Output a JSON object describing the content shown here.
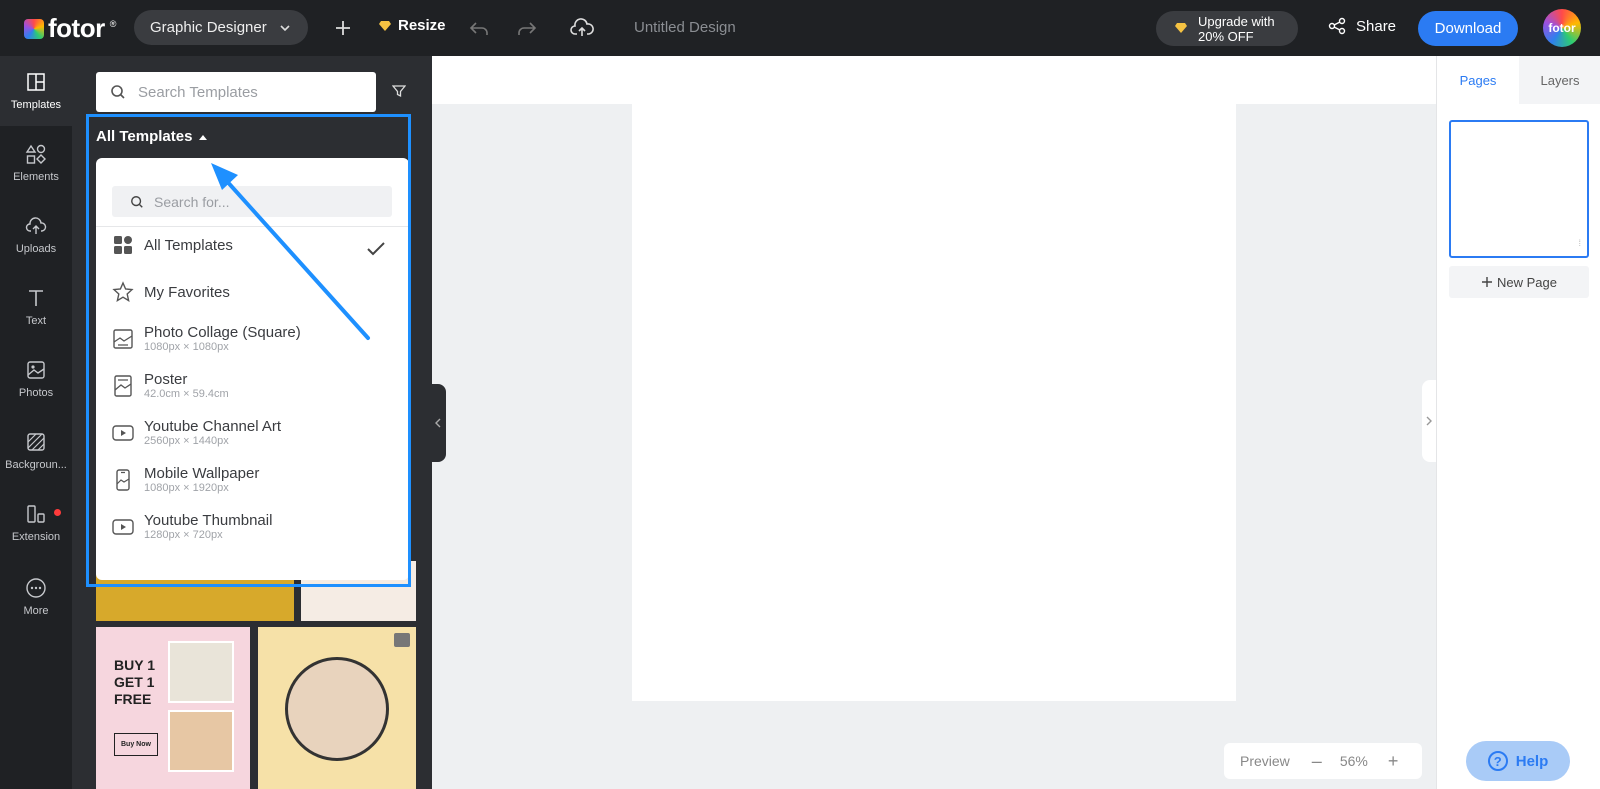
{
  "topbar": {
    "logo_text": "fotor",
    "logo_reg": "®",
    "role_label": "Graphic Designer",
    "resize_label": "Resize",
    "doc_title": "Untitled Design",
    "upgrade_line1": "Upgrade with",
    "upgrade_line2": "20% OFF",
    "share_label": "Share",
    "download_label": "Download",
    "avatar_text": "fotor"
  },
  "leftnav": {
    "items": [
      {
        "label": "Templates",
        "icon": "templates-icon"
      },
      {
        "label": "Elements",
        "icon": "elements-icon"
      },
      {
        "label": "Uploads",
        "icon": "upload-cloud-icon"
      },
      {
        "label": "Text",
        "icon": "text-icon"
      },
      {
        "label": "Photos",
        "icon": "photo-icon"
      },
      {
        "label": "Backgroun...",
        "icon": "background-icon"
      },
      {
        "label": "Extension",
        "icon": "extension-icon"
      },
      {
        "label": "More",
        "icon": "more-icon"
      }
    ]
  },
  "panel": {
    "search_placeholder": "Search Templates",
    "dropdown_header": "All Templates",
    "dropdown_search_placeholder": "Search for...",
    "items": [
      {
        "label": "All Templates",
        "size": ""
      },
      {
        "label": "My Favorites",
        "size": ""
      },
      {
        "label": "Photo Collage (Square)",
        "size": "1080px × 1080px"
      },
      {
        "label": "Poster",
        "size": "42.0cm × 59.4cm"
      },
      {
        "label": "Youtube Channel Art",
        "size": "2560px × 1440px"
      },
      {
        "label": "Mobile Wallpaper",
        "size": "1080px × 1920px"
      },
      {
        "label": "Youtube Thumbnail",
        "size": "1280px × 720px"
      }
    ],
    "template_c": {
      "line1": "BUY 1",
      "line2": "GET 1",
      "line3": "FREE",
      "button": "Buy Now"
    }
  },
  "canvas": {
    "zoom_preview": "Preview",
    "zoom_value": "56%"
  },
  "rightpanel": {
    "tab_pages": "Pages",
    "tab_layers": "Layers",
    "new_page": "New Page"
  },
  "help_label": "Help",
  "colors": {
    "accent": "#2b7bf3",
    "highlight": "#1e90ff",
    "dark_bg": "#1f2124",
    "panel_bg": "#2c2e32"
  }
}
